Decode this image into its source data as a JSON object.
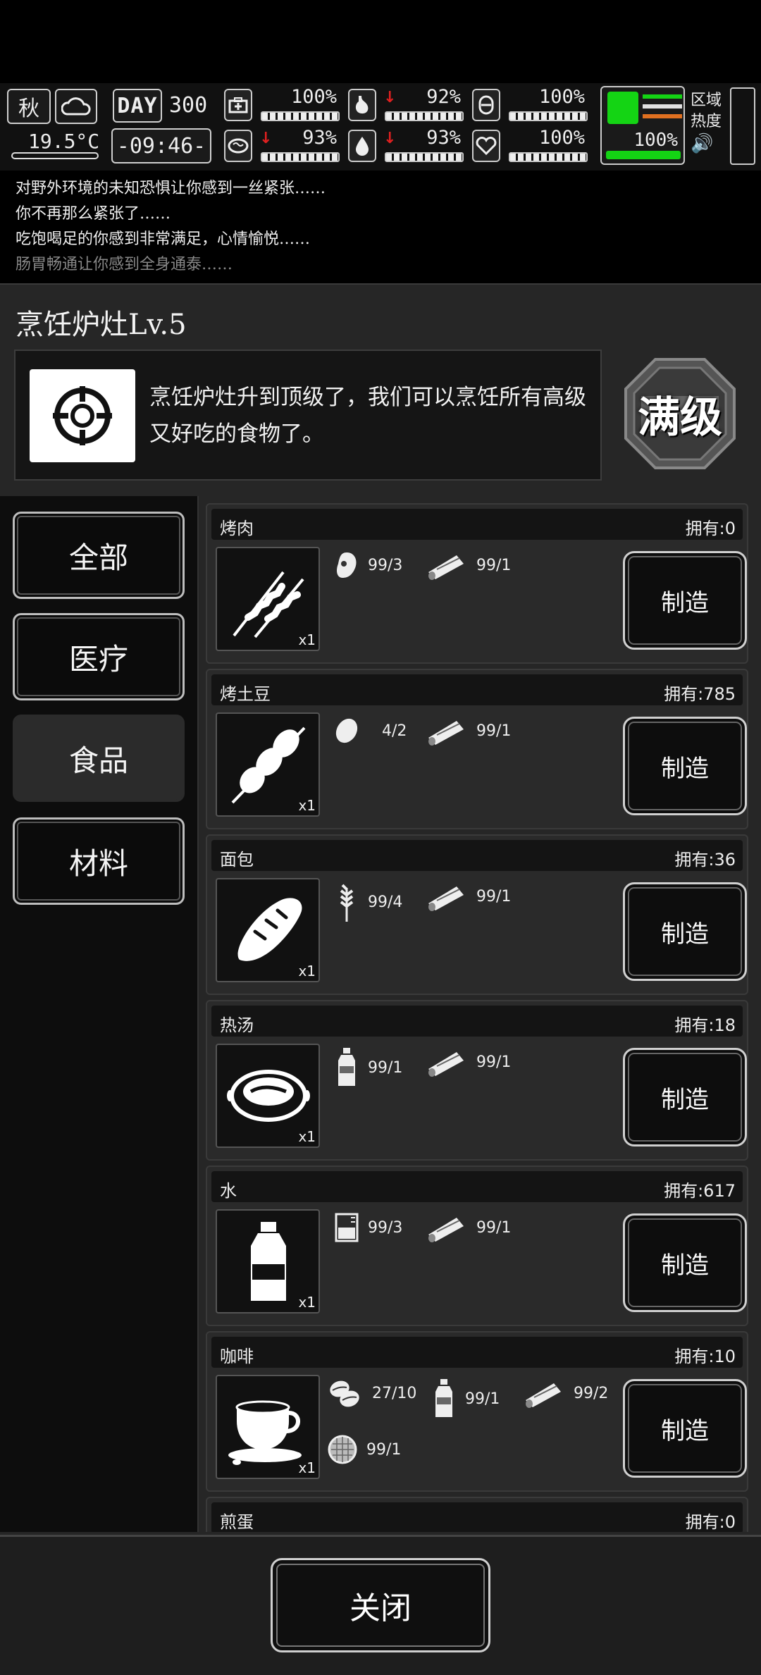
{
  "hud": {
    "season": "秋",
    "temperature": "19.5°C",
    "day_label": "DAY",
    "day_number": "300",
    "clock": "-09:46-",
    "stats": [
      {
        "icon": "medkit-icon",
        "value": "100%",
        "down": false
      },
      {
        "icon": "stomach-icon",
        "value": "92%",
        "down": true
      },
      {
        "icon": "bladder-icon",
        "value": "100%",
        "down": false
      },
      {
        "icon": "brain-icon",
        "value": "93%",
        "down": true
      },
      {
        "icon": "water-drop-icon",
        "value": "93%",
        "down": true
      },
      {
        "icon": "heart-icon",
        "value": "100%",
        "down": false
      }
    ],
    "stamina": "100%",
    "stamina_color": "#14d414",
    "zone_line1": "区域",
    "zone_line2": "热度"
  },
  "log": [
    "对野外环境的未知恐惧让你感到一丝紧张……",
    "你不再那么紧张了……",
    "吃饱喝足的你感到非常满足，心情愉悦……",
    "肠胃畅通让你感到全身通泰……"
  ],
  "station": {
    "title": "烹饪炉灶Lv.5",
    "description": "烹饪炉灶升到顶级了，我们可以烹饪所有高级又好吃的食物了。",
    "badge": "满级"
  },
  "categories": [
    "全部",
    "医疗",
    "食品",
    "材料"
  ],
  "active_category": "食品",
  "recipes": [
    {
      "name": "烤肉",
      "owned": "拥有:0",
      "qty": "x1",
      "ingredients": [
        {
          "icon": "meat-icon",
          "text": "99/3"
        },
        {
          "icon": "firewood-icon",
          "text": "99/1"
        }
      ],
      "button": "制造"
    },
    {
      "name": "烤土豆",
      "owned": "拥有:785",
      "qty": "x1",
      "ingredients": [
        {
          "icon": "potato-icon",
          "text": "4/2"
        },
        {
          "icon": "firewood-icon",
          "text": "99/1"
        }
      ],
      "button": "制造"
    },
    {
      "name": "面包",
      "owned": "拥有:36",
      "qty": "x1",
      "ingredients": [
        {
          "icon": "wheat-icon",
          "text": "99/4"
        },
        {
          "icon": "firewood-icon",
          "text": "99/1"
        }
      ],
      "button": "制造"
    },
    {
      "name": "热汤",
      "owned": "拥有:18",
      "qty": "x1",
      "ingredients": [
        {
          "icon": "bottle-icon",
          "text": "99/1"
        },
        {
          "icon": "firewood-icon",
          "text": "99/1"
        }
      ],
      "button": "制造"
    },
    {
      "name": "水",
      "owned": "拥有:617",
      "qty": "x1",
      "ingredients": [
        {
          "icon": "beaker-icon",
          "text": "99/3"
        },
        {
          "icon": "firewood-icon",
          "text": "99/1"
        }
      ],
      "button": "制造"
    },
    {
      "name": "咖啡",
      "owned": "拥有:10",
      "qty": "x1",
      "ingredients": [
        {
          "icon": "coffee-beans-icon",
          "text": "27/10"
        },
        {
          "icon": "bottle-icon",
          "text": "99/1"
        },
        {
          "icon": "firewood-icon",
          "text": "99/2"
        },
        {
          "icon": "filter-icon",
          "text": "99/1"
        }
      ],
      "button": "制造"
    },
    {
      "name": "煎蛋",
      "owned": "拥有:0"
    }
  ],
  "close_button": "关闭"
}
